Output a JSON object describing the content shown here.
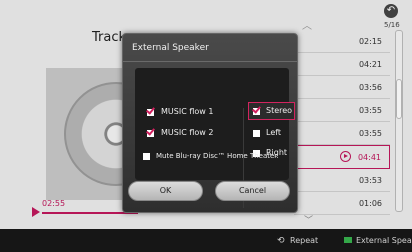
{
  "header": {
    "track_title": "Track",
    "counter": "5/16"
  },
  "player": {
    "elapsed": "02:55",
    "progress_fraction": 0.3
  },
  "tracklist": {
    "items": [
      {
        "time": "02:15"
      },
      {
        "time": "04:21"
      },
      {
        "time": "03:56"
      },
      {
        "time": "03:55"
      },
      {
        "time": "03:55"
      },
      {
        "time": "04:41",
        "active": true
      },
      {
        "time": "03:53"
      },
      {
        "time": "01:06"
      }
    ]
  },
  "dialog": {
    "title": "External Speaker",
    "options_left": [
      {
        "label": "MUSIC flow 1",
        "checked": true
      },
      {
        "label": "MUSIC flow 2",
        "checked": true
      }
    ],
    "options_right": [
      {
        "label": "Stereo",
        "checked": true
      },
      {
        "label": "Left",
        "checked": false
      },
      {
        "label": "Right",
        "checked": false
      }
    ],
    "mute_label": "Mute Blu-ray Disc™ Home Theater.",
    "ok_label": "OK",
    "cancel_label": "Cancel"
  },
  "bottombar": {
    "repeat_label": "Repeat",
    "external_speaker_label": "External Speaker"
  },
  "colors": {
    "accent": "#c0185c",
    "green_key": "#37b24d"
  }
}
